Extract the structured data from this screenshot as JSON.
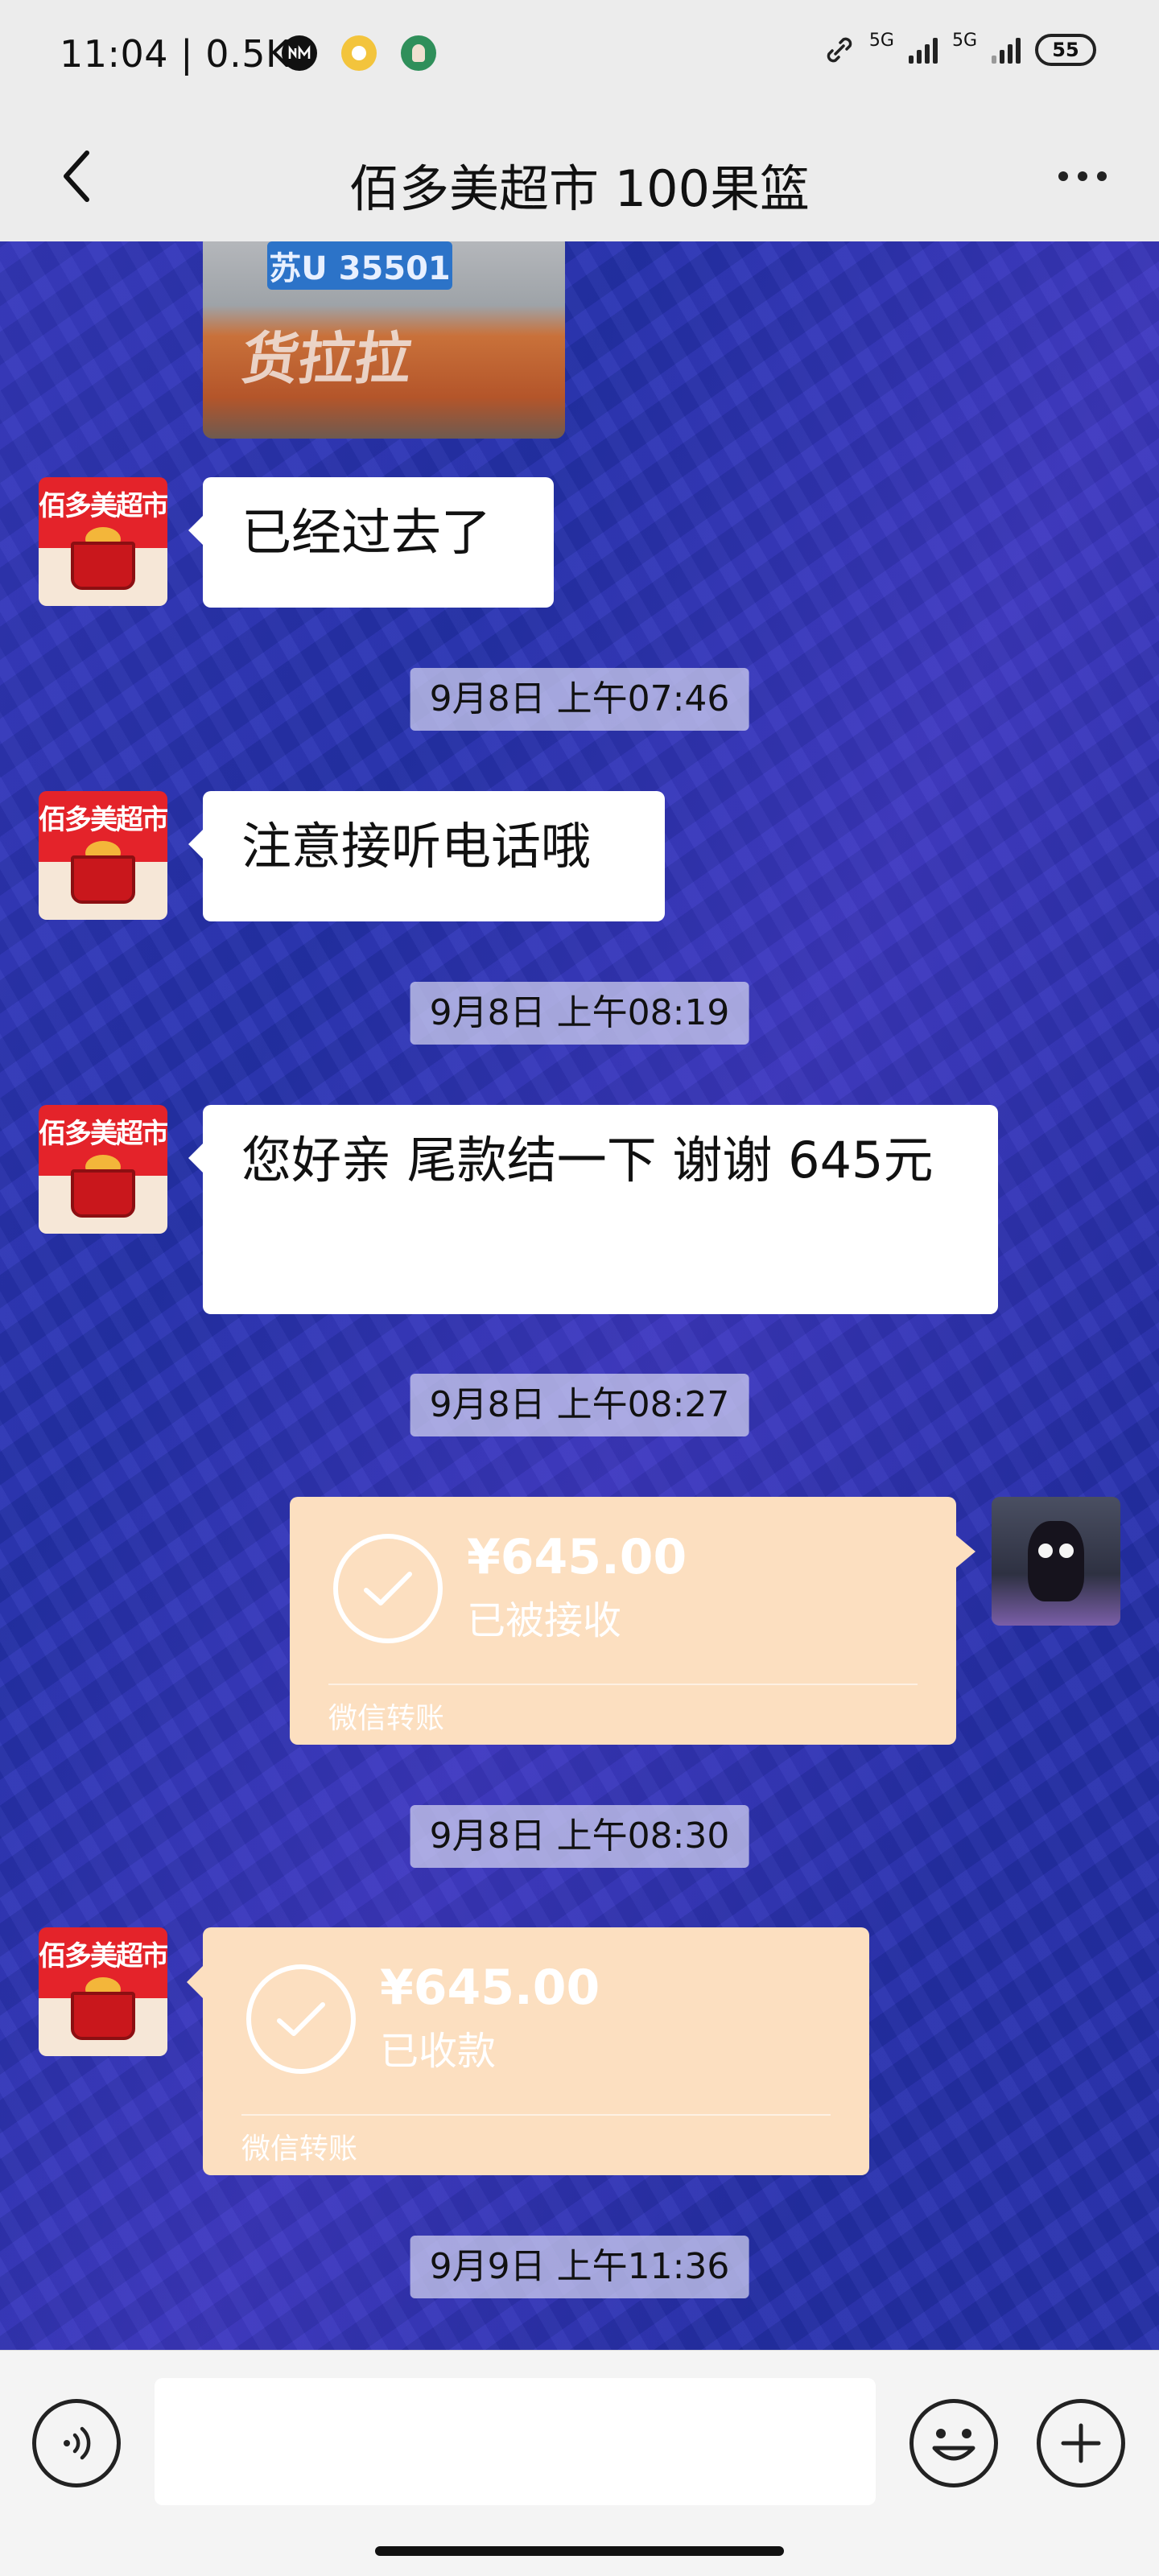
{
  "status_bar": {
    "time": "11:04 | 0.5K",
    "network_1": "5G",
    "network_2": "5G",
    "battery": "55",
    "icons": [
      "nm-icon",
      "circle-icon",
      "avatar-icon",
      "link-icon",
      "signal-icon",
      "signal-icon",
      "battery-icon"
    ]
  },
  "header": {
    "title": "佰多美超市 100果篮",
    "back_icon": "chevron-left-icon",
    "more_icon": "more-dots-icon"
  },
  "messages": {
    "photo": {
      "plate_text": "苏U 35501",
      "overlay_text": "货拉拉"
    },
    "avatar_store_text": "佰多美超市",
    "m1_text": "已经过去了",
    "t1": "9月8日 上午07:46",
    "m2_text": "注意接听电话哦",
    "t2": "9月8日 上午08:19",
    "m3_text": "您好亲 尾款结一下 谢谢 645元",
    "t3": "9月8日 上午08:27",
    "transfer_sent": {
      "amount": "¥645.00",
      "status": "已被接收",
      "footer": "微信转账"
    },
    "t4": "9月8日 上午08:30",
    "transfer_received": {
      "amount": "¥645.00",
      "status": "已收款",
      "footer": "微信转账"
    },
    "t5": "9月9日 上午11:36"
  },
  "input_bar": {
    "placeholder": "",
    "voice_icon": "voice-icon",
    "emoji_icon": "emoji-icon",
    "plus_icon": "plus-icon"
  },
  "colors": {
    "transfer_bg": "#fcdfc0",
    "chat_bg": "#2a36b0",
    "store_red": "#e4232a"
  }
}
